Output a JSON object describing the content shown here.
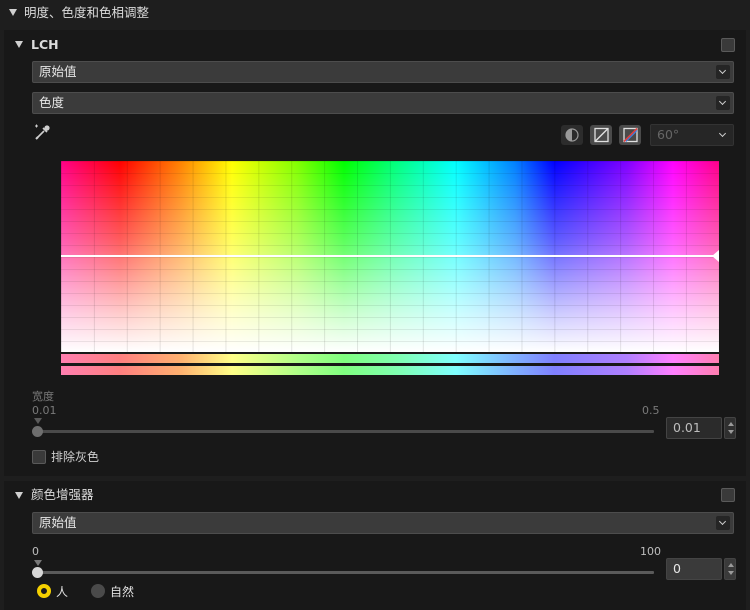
{
  "section": {
    "title": "明度、色度和色相调整"
  },
  "lch": {
    "title": "LCH",
    "preset": "原始值",
    "channel": "色度",
    "angle": "60°",
    "width_label": "宽度",
    "width_min": "0.01",
    "width_max": "0.5",
    "width_value": "0.01",
    "width_level": 0.0,
    "exclude_gray": "排除灰色",
    "curve_level": 0.49
  },
  "enhancer": {
    "title": "颜色增强器",
    "preset": "原始值",
    "min": "0",
    "max": "100",
    "value": "0",
    "level": 0,
    "options": [
      "人",
      "自然"
    ],
    "selected": 0
  },
  "colors": {
    "accent": "#f5d000",
    "panel": "#181818",
    "header": "#1e1e1e"
  }
}
